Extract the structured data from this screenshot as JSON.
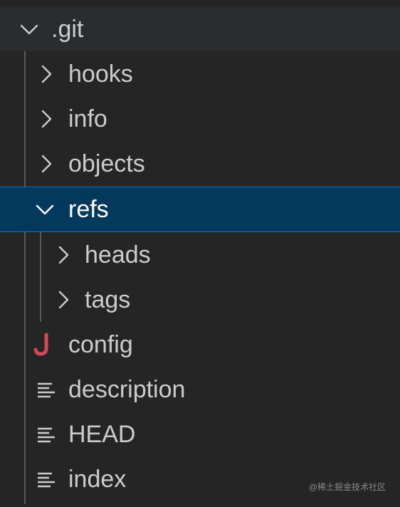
{
  "explorer": {
    "root": {
      "label": ".git",
      "expanded": true
    },
    "items": [
      {
        "label": "hooks",
        "icon": "chevron-right-icon",
        "type": "folder"
      },
      {
        "label": "info",
        "icon": "chevron-right-icon",
        "type": "folder"
      },
      {
        "label": "objects",
        "icon": "chevron-right-icon",
        "type": "folder"
      },
      {
        "label": "refs",
        "icon": "chevron-down-icon",
        "type": "folder",
        "expanded": true,
        "selected": true
      },
      {
        "label": "heads",
        "icon": "chevron-right-icon",
        "type": "folder"
      },
      {
        "label": "tags",
        "icon": "chevron-right-icon",
        "type": "folder"
      },
      {
        "label": "config",
        "icon": "json-icon",
        "type": "file"
      },
      {
        "label": "description",
        "icon": "text-file-icon",
        "type": "file"
      },
      {
        "label": "HEAD",
        "icon": "text-file-icon",
        "type": "file"
      },
      {
        "label": "index",
        "icon": "text-file-icon",
        "type": "file"
      }
    ]
  },
  "watermark": "@稀土掘金技术社区",
  "colors": {
    "background": "#252526",
    "selected": "#04395e",
    "selected_border": "#0f73c8",
    "text": "#cccccc",
    "json_icon": "#d14a56"
  }
}
